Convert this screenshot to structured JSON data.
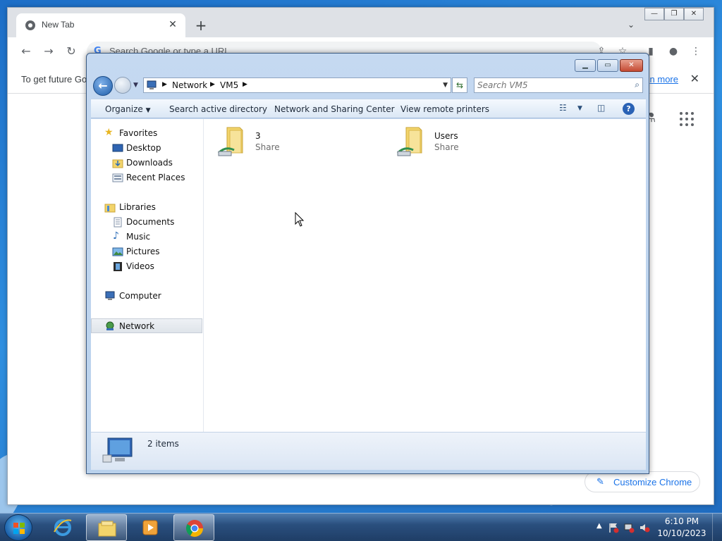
{
  "chrome": {
    "tab_title": "New Tab",
    "omnibox_placeholder": "Search Google or type a URL",
    "infobar_message": "To get future Go",
    "infobar_link": "n more",
    "customize_label": "Customize Chrome"
  },
  "explorer": {
    "breadcrumb": [
      "Network",
      "VM5"
    ],
    "search_placeholder": "Search VM5",
    "commands": {
      "organize": "Organize",
      "search_ad": "Search active directory",
      "network_sharing": "Network and Sharing Center",
      "remote_printers": "View remote printers"
    },
    "nav": {
      "favorites": "Favorites",
      "desktop": "Desktop",
      "downloads": "Downloads",
      "recent_places": "Recent Places",
      "libraries": "Libraries",
      "documents": "Documents",
      "music": "Music",
      "pictures": "Pictures",
      "videos": "Videos",
      "computer": "Computer",
      "network": "Network"
    },
    "items": [
      {
        "name": "3",
        "type": "Share"
      },
      {
        "name": "Users",
        "type": "Share"
      }
    ],
    "status_count": "2 items"
  },
  "taskbar": {
    "time": "6:10 PM",
    "date": "10/10/2023"
  },
  "colors": {
    "desktop_blue": "#2f7fd0",
    "link_blue": "#1a73e8",
    "folder_yellow": "#f2d46b"
  }
}
